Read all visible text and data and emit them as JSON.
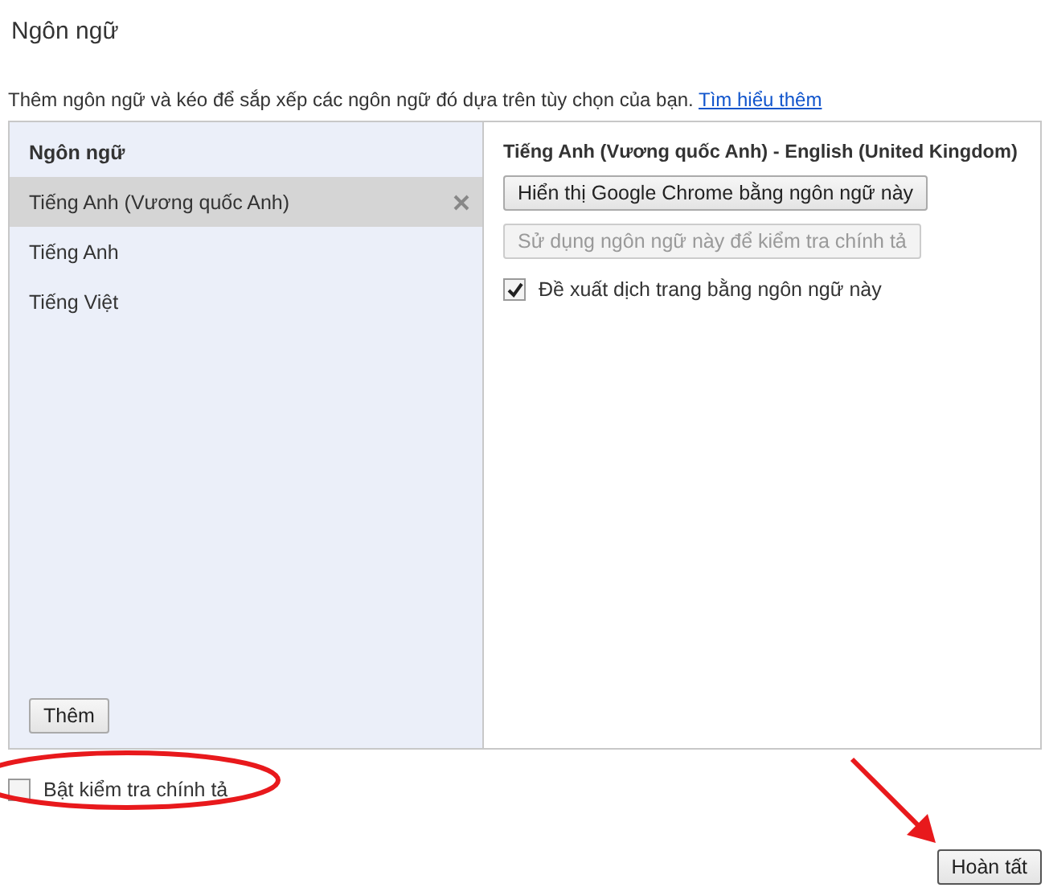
{
  "dialog": {
    "title": "Ngôn ngữ",
    "description": "Thêm ngôn ngữ và kéo để sắp xếp các ngôn ngữ đó dựa trên tùy chọn của bạn.",
    "learn_more_link": "Tìm hiểu thêm"
  },
  "language_list": {
    "header": "Ngôn ngữ",
    "items": [
      {
        "label": "Tiếng Anh (Vương quốc Anh)",
        "selected": true
      },
      {
        "label": "Tiếng Anh",
        "selected": false
      },
      {
        "label": "Tiếng Việt",
        "selected": false
      }
    ],
    "add_button": "Thêm"
  },
  "details": {
    "title": "Tiếng Anh (Vương quốc Anh) - English (United Kingdom)",
    "buttons": [
      {
        "label": "Hiển thị Google Chrome bằng ngôn ngữ này",
        "disabled": false
      },
      {
        "label": "Sử dụng ngôn ngữ này để kiểm tra chính tả",
        "disabled": true
      }
    ],
    "translate_option": {
      "label": "Đề xuất dịch trang bằng ngôn ngữ này",
      "checked": true
    }
  },
  "spell_check": {
    "label": "Bật kiểm tra chính tả",
    "checked": false
  },
  "done_button": "Hoàn tất"
}
